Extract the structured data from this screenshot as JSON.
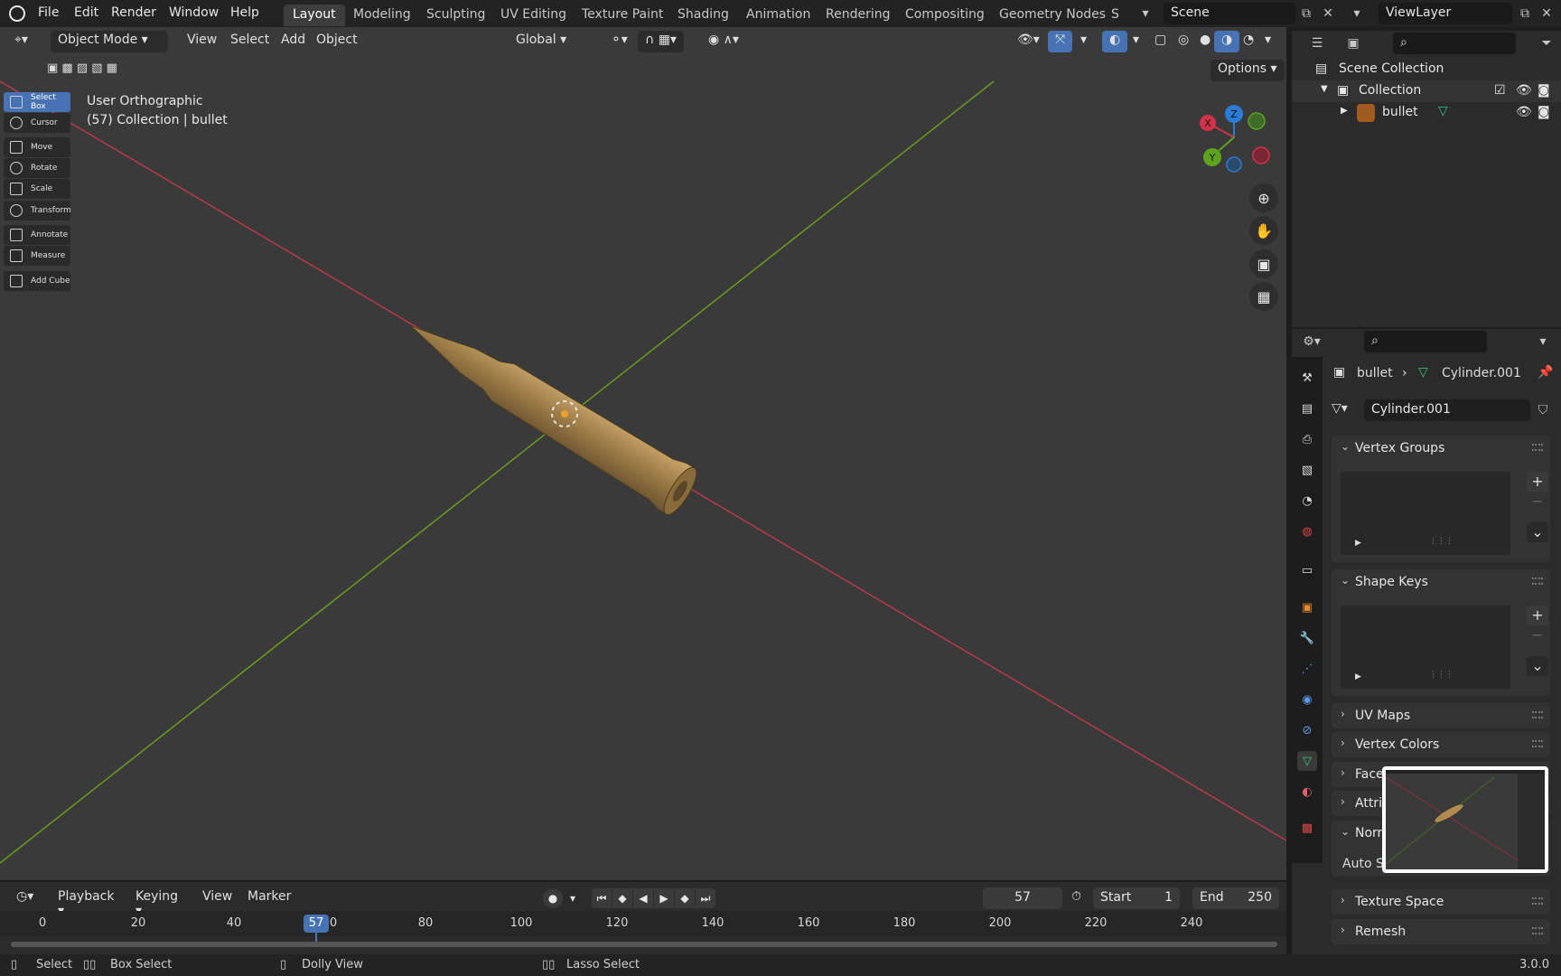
{
  "topbar": {
    "menus": [
      "File",
      "Edit",
      "Render",
      "Window",
      "Help"
    ],
    "workspaces": [
      "Layout",
      "Modeling",
      "Sculpting",
      "UV Editing",
      "Texture Paint",
      "Shading",
      "Animation",
      "Rendering",
      "Compositing",
      "Geometry Nodes",
      "S"
    ],
    "active_workspace": "Layout",
    "scene": "Scene",
    "view_layer": "ViewLayer"
  },
  "viewport": {
    "mode": "Object Mode",
    "menus": [
      "View",
      "Select",
      "Add",
      "Object"
    ],
    "transform_orientation": "Global",
    "options_label": "Options",
    "view_name": "User Orthographic",
    "context_info": "(57) Collection | bullet",
    "tools": [
      "Select Box",
      "Cursor",
      "Move",
      "Rotate",
      "Scale",
      "Transform",
      "Annotate",
      "Measure",
      "Add Cube"
    ],
    "active_tool": "Select Box",
    "gizmo": {
      "x": "X",
      "y": "Y",
      "z": "Z"
    }
  },
  "outliner": {
    "scene_collection": "Scene Collection",
    "collection": "Collection",
    "object": "bullet"
  },
  "properties": {
    "object_name": "bullet",
    "mesh_name": "Cylinder.001",
    "data_field": "Cylinder.001",
    "panels": [
      "Vertex Groups",
      "Shape Keys",
      "UV Maps",
      "Vertex Colors",
      "Face",
      "Attrib",
      "Norm",
      "Texture Space",
      "Remesh"
    ],
    "auto_smooth_label": "Auto S"
  },
  "timeline": {
    "menus": [
      "Playback",
      "Keying",
      "View",
      "Marker"
    ],
    "current_frame": "57",
    "start_label": "Start",
    "start_value": "1",
    "end_label": "End",
    "end_value": "250",
    "ticks": [
      "0",
      "20",
      "40",
      "57",
      "0",
      "80",
      "100",
      "120",
      "140",
      "160",
      "180",
      "200",
      "220",
      "240"
    ]
  },
  "statusbar": {
    "select": "Select",
    "box_select": "Box Select",
    "dolly_view": "Dolly View",
    "lasso_select": "Lasso Select",
    "version": "3.0.0"
  }
}
